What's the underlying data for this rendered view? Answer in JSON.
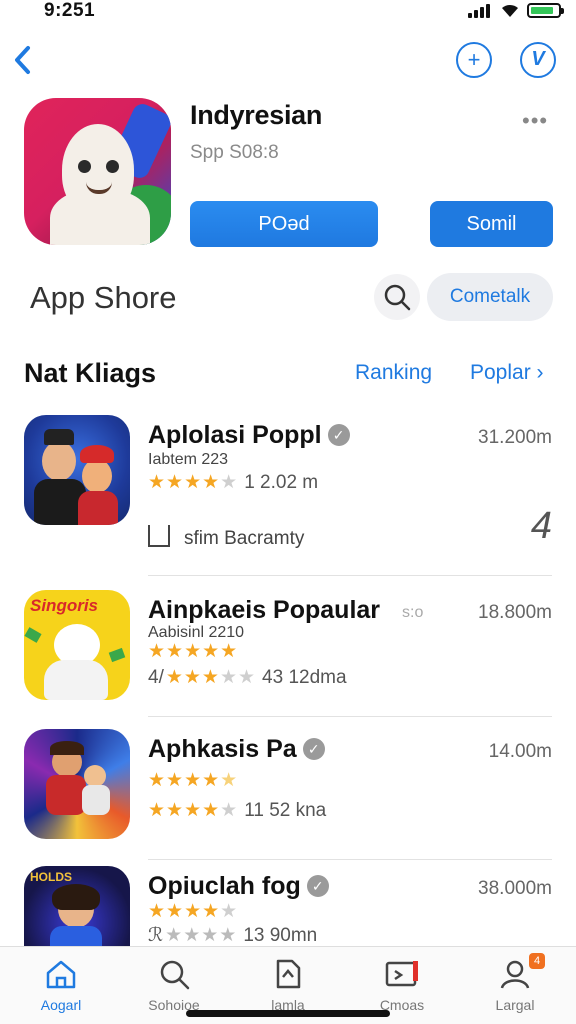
{
  "status_bar": {
    "time": "9:251"
  },
  "app": {
    "title": "Indyresian",
    "subtitle": "Spp S08:8",
    "get_label": "POəd",
    "share_label": "Somil"
  },
  "store": {
    "title": "App Shore",
    "contact_label": "Cometalk"
  },
  "section": {
    "title": "Nat Kliags",
    "ranking_label": "Ranking",
    "popular_label": "Poplar ›"
  },
  "items": [
    {
      "name": "Aplolasi Poppl",
      "size": "31.200m",
      "subtitle": "Iabtem 223",
      "rating": 4,
      "rating_text": "1 2.02 m",
      "share_text": "sfim  Bacramty",
      "rank": "4",
      "icon": "creator-duo-icon"
    },
    {
      "name": "Ainpkaeis Popaular",
      "size": "18.800m",
      "side_mark": "s:o",
      "subtitle": "Aabisinl 2210",
      "rating": 5,
      "rating2": 3,
      "rating_text": "43 12dma",
      "prefix": "4/",
      "icon": "singoris-bear-icon"
    },
    {
      "name": "Aphkasis Pa",
      "size": "14.00m",
      "rating": 4,
      "rating2": 4,
      "rating_text": "11 52 kna",
      "icon": "action-hero-icon"
    },
    {
      "name": "Opiuclah fog",
      "size": "38.000m",
      "rating": 4,
      "rating_text": "13 90mn",
      "prefix": "ℛ",
      "icon": "arcade-girl-icon"
    }
  ],
  "tabs": [
    {
      "label": "Aogarl",
      "icon": "home-icon"
    },
    {
      "label": "Sohoioe",
      "icon": "search-icon"
    },
    {
      "label": "lamla",
      "icon": "document-icon"
    },
    {
      "label": "Cmoas",
      "icon": "games-icon"
    },
    {
      "label": "Largal",
      "icon": "profile-icon",
      "badge": "4"
    }
  ],
  "colors": {
    "accent": "#1f7ae0",
    "star": "#f5a623",
    "icon_primary": "#d6205f"
  }
}
